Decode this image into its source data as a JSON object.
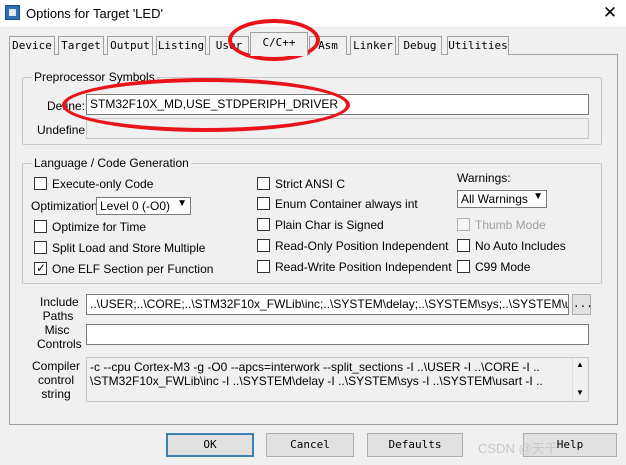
{
  "window": {
    "title": "Options for Target 'LED'",
    "close_glyph": "✕"
  },
  "tabs": [
    {
      "label": "Device"
    },
    {
      "label": "Target"
    },
    {
      "label": "Output"
    },
    {
      "label": "Listing"
    },
    {
      "label": "User"
    },
    {
      "label": "C/C++",
      "active": true
    },
    {
      "label": "Asm"
    },
    {
      "label": "Linker"
    },
    {
      "label": "Debug"
    },
    {
      "label": "Utilities"
    }
  ],
  "preprocessor": {
    "legend": "Preprocessor Symbols",
    "define_label": "Define:",
    "define_value": "STM32F10X_MD,USE_STDPERIPH_DRIVER",
    "undefine_label": "Undefine:",
    "undefine_value": ""
  },
  "language": {
    "legend": "Language / Code Generation",
    "execute_only": {
      "label": "Execute-only Code",
      "checked": false
    },
    "optimization_label": "Optimization:",
    "optimization_value": "Level 0 (-O0)",
    "optimize_time": {
      "label": "Optimize for Time",
      "checked": false
    },
    "split_load": {
      "label": "Split Load and Store Multiple",
      "checked": false
    },
    "one_elf": {
      "label": "One ELF Section per Function",
      "checked": true
    },
    "strict_ansi": {
      "label": "Strict ANSI C",
      "checked": false
    },
    "enum_container": {
      "label": "Enum Container always int",
      "checked": false
    },
    "plain_char": {
      "label": "Plain Char is Signed",
      "checked": false
    },
    "ro_pi": {
      "label": "Read-Only Position Independent",
      "checked": false
    },
    "rw_pi": {
      "label": "Read-Write Position Independent",
      "checked": false
    },
    "warnings_label": "Warnings:",
    "warnings_value": "All Warnings",
    "thumb_mode": {
      "label": "Thumb Mode",
      "checked": false,
      "disabled": true
    },
    "no_auto_includes": {
      "label": "No Auto Includes",
      "checked": false
    },
    "c99_mode": {
      "label": "C99 Mode",
      "checked": false
    }
  },
  "include_paths": {
    "label_line1": "Include",
    "label_line2": "Paths",
    "value": "..\\USER;..\\CORE;..\\STM32F10x_FWLib\\inc;..\\SYSTEM\\delay;..\\SYSTEM\\sys;..\\SYSTEM\\usart;..\\",
    "browse_label": "..."
  },
  "misc_controls": {
    "label_line1": "Misc",
    "label_line2": "Controls",
    "value": ""
  },
  "compiler_string": {
    "label_line1": "Compiler",
    "label_line2": "control",
    "label_line3": "string",
    "line1": "-c --cpu Cortex-M3 -g -O0 --apcs=interwork --split_sections -I ..\\USER -I ..\\CORE -I ..",
    "line2": "\\STM32F10x_FWLib\\inc -I ..\\SYSTEM\\delay -I ..\\SYSTEM\\sys -I ..\\SYSTEM\\usart -I .."
  },
  "buttons": {
    "ok": "OK",
    "cancel": "Cancel",
    "defaults": "Defaults",
    "help": "Help"
  },
  "watermark": "CSDN @天千",
  "colors": {
    "annotation": "#e8141a",
    "default_button_border": "#3c7fb1"
  }
}
